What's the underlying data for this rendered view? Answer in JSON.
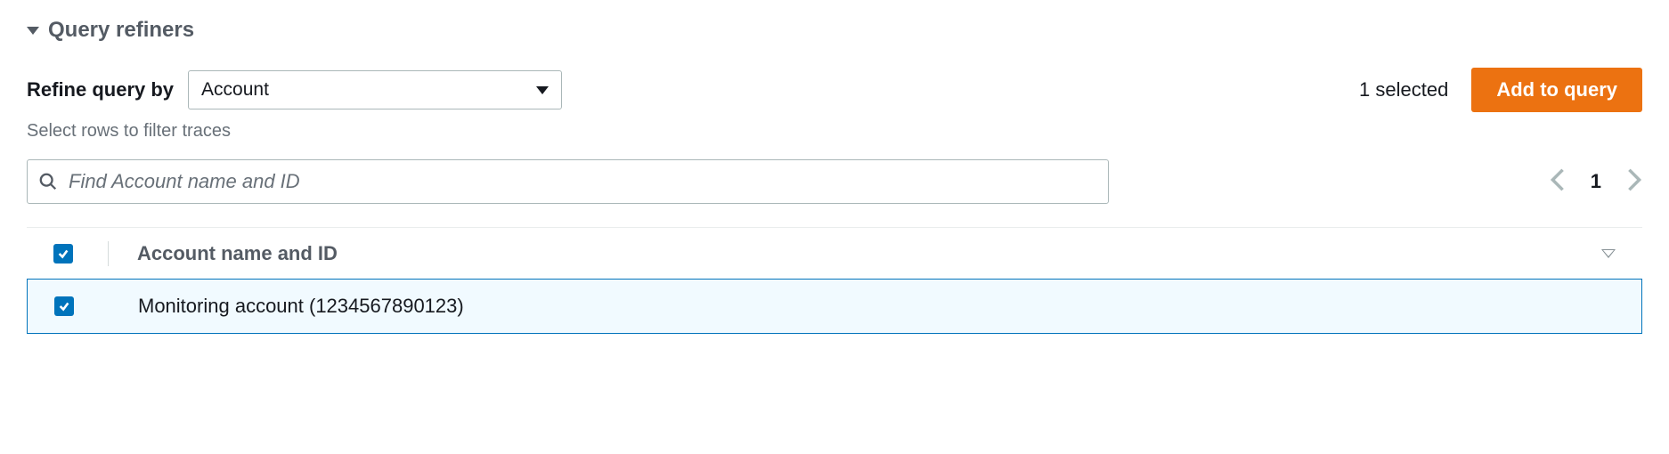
{
  "section": {
    "title": "Query refiners"
  },
  "refine": {
    "label": "Refine query by",
    "select_value": "Account",
    "selected_text": "1 selected",
    "button_label": "Add to query",
    "hint": "Select rows to filter traces"
  },
  "search": {
    "placeholder": "Find Account name and ID"
  },
  "pagination": {
    "current": "1"
  },
  "table": {
    "header": "Account name and ID",
    "rows": [
      {
        "name": "Monitoring account (1234567890123)",
        "checked": true
      }
    ]
  }
}
